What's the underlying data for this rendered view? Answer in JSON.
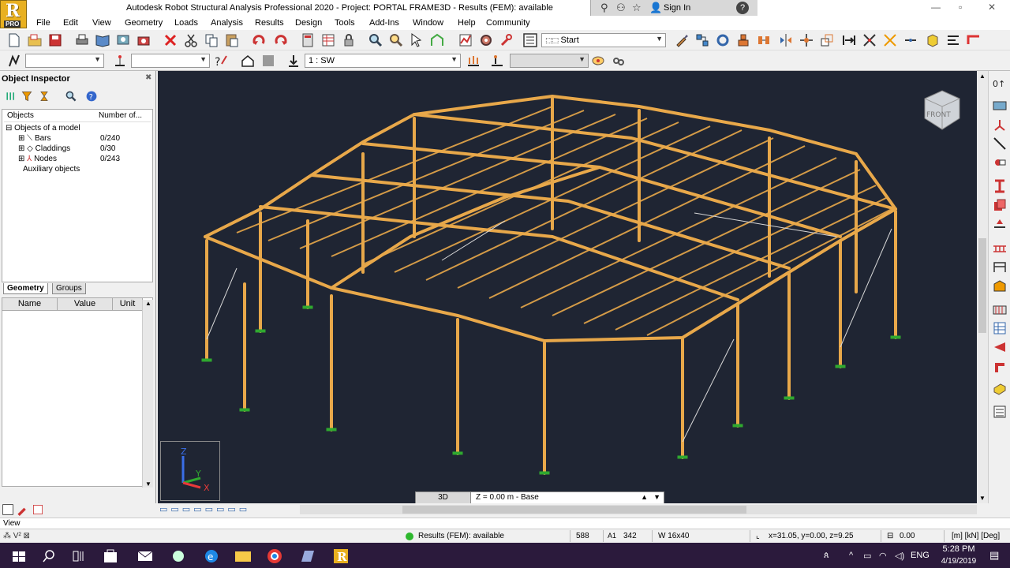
{
  "window": {
    "title": "Autodesk Robot Structural Analysis Professional 2020 - Project: PORTAL FRAME3D - Results (FEM): available",
    "logo_letter": "R",
    "logo_badge": "PRO",
    "sign_in": "Sign In"
  },
  "menu": [
    "File",
    "Edit",
    "View",
    "Geometry",
    "Loads",
    "Analysis",
    "Results",
    "Design",
    "Tools",
    "Add-Ins",
    "Window",
    "Help",
    "Community"
  ],
  "toolbar": {
    "layout_combo": "Start",
    "case_combo": "1 : SW",
    "combo_left_1": "",
    "combo_left_2": ""
  },
  "inspector": {
    "title": "Object Inspector",
    "col_objects": "Objects",
    "col_number": "Number of...",
    "root": "Objects of a model",
    "items": [
      {
        "label": "Bars",
        "count": "0/240"
      },
      {
        "label": "Claddings",
        "count": "0/30"
      },
      {
        "label": "Nodes",
        "count": "0/243"
      }
    ],
    "aux": "Auxiliary objects",
    "tabs": [
      "Geometry",
      "Groups"
    ],
    "prop_headers": [
      "Name",
      "Value",
      "Unit"
    ]
  },
  "viewport": {
    "view_mode": "3D",
    "view_plane": "Z = 0.00 m - Base",
    "cube_label": "FRONT",
    "axes": [
      "Z",
      "Y",
      "X"
    ],
    "colors": {
      "background": "#1f2533",
      "members": "#e8a84a",
      "bracing": "#d8d8d8",
      "supports": "#2fa82f"
    }
  },
  "statusbar": {
    "view_label": "View",
    "results": "Results (FEM): available",
    "node_count": "588",
    "bar_label": "342",
    "section": "W 16x40",
    "coords": "x=31.05, y=0.00, z=9.25",
    "value": "0.00",
    "units": "[m] [kN] [Deg]"
  },
  "taskbar": {
    "language": "ENG",
    "time": "5:28 PM",
    "date": "4/19/2019"
  }
}
